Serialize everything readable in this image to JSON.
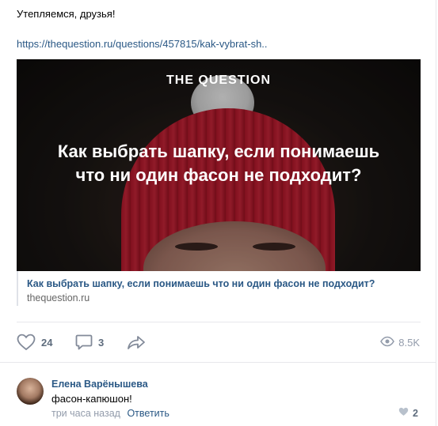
{
  "post": {
    "text": "Утепляемся, друзья!",
    "link": "https://thequestion.ru/questions/457815/kak-vybrat-sh.."
  },
  "snippet": {
    "brand": "THE QUESTION",
    "headline_line1": "Как выбрать шапку, если понимаешь",
    "headline_line2": "что ни один фасон не подходит?",
    "title": "Как выбрать шапку, если понимаешь что ни один фасон не подходит?",
    "domain": "thequestion.ru"
  },
  "actions": {
    "likes": "24",
    "comments": "3",
    "views": "8.5K"
  },
  "comment": {
    "author": "Елена Варёнышева",
    "text": "фасон-капюшон!",
    "time": "три часа назад",
    "reply_label": "Ответить",
    "likes": "2"
  },
  "colors": {
    "link": "#2a5885",
    "icon": "#828a99",
    "divider": "#e7e8ec"
  },
  "icons": [
    "heart-icon",
    "comment-icon",
    "share-icon",
    "eye-icon"
  ]
}
